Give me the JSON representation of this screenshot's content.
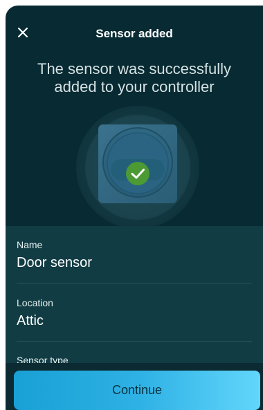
{
  "header": {
    "title": "Sensor added"
  },
  "hero": {
    "message": "The sensor was successfully added to your controller"
  },
  "details": {
    "fields": [
      {
        "label": "Name",
        "value": "Door sensor"
      },
      {
        "label": "Location",
        "value": "Attic"
      },
      {
        "label": "Sensor type",
        "value": ""
      }
    ]
  },
  "footer": {
    "continue_label": "Continue"
  },
  "icons": {
    "close": "close-icon",
    "success": "checkmark-icon"
  },
  "colors": {
    "hero_background": "#082a32",
    "details_background": "#113c44",
    "footer_background": "#0b2a31",
    "accent_start": "#19a0d5",
    "accent_end": "#62d6fb",
    "success": "#4b9a34"
  }
}
